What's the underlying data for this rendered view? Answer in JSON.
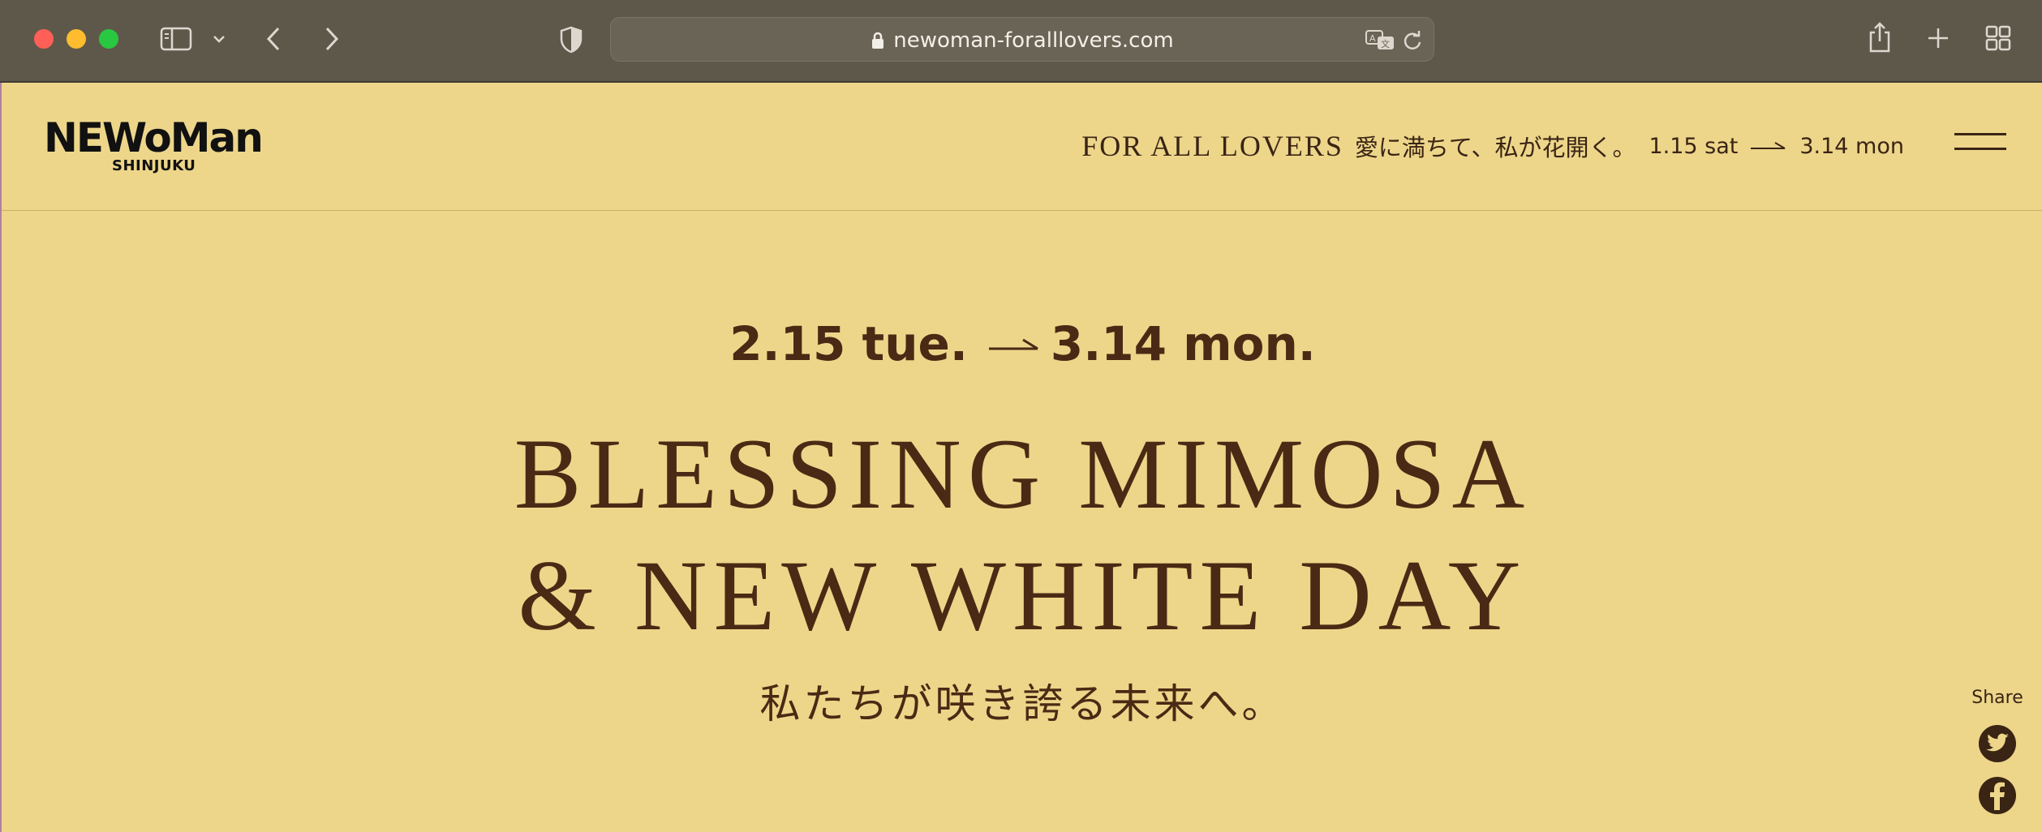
{
  "browser": {
    "url": "newoman-foralllovers.com",
    "icons": [
      "sidebar-icon",
      "chevron-down-icon",
      "back-icon",
      "forward-icon",
      "privacy-shield-icon",
      "lock-icon",
      "translate-icon",
      "reload-icon",
      "share-icon",
      "new-tab-icon",
      "tab-overview-icon"
    ]
  },
  "header": {
    "logo_main": "NEWoMan",
    "logo_sub": "SHINJUKU",
    "tagline_en": "FOR ALL LOVERS",
    "tagline_jp": "愛に満ちて、私が花開く。",
    "date_start": "1.15 sat",
    "date_end": "3.14 mon"
  },
  "hero": {
    "date_start": "2.15 tue.",
    "date_end": "3.14 mon.",
    "title_line1": "BLESSING MIMOSA",
    "title_line2": "& NEW WHITE DAY",
    "subtitle": "私たちが咲き誇る未来へ。"
  },
  "share": {
    "label": "Share",
    "icons": [
      "twitter-icon",
      "facebook-icon"
    ]
  },
  "colors": {
    "page_bg": "#edd68a",
    "text_brown": "#4a2a14",
    "chrome_bg": "#5e584b"
  }
}
